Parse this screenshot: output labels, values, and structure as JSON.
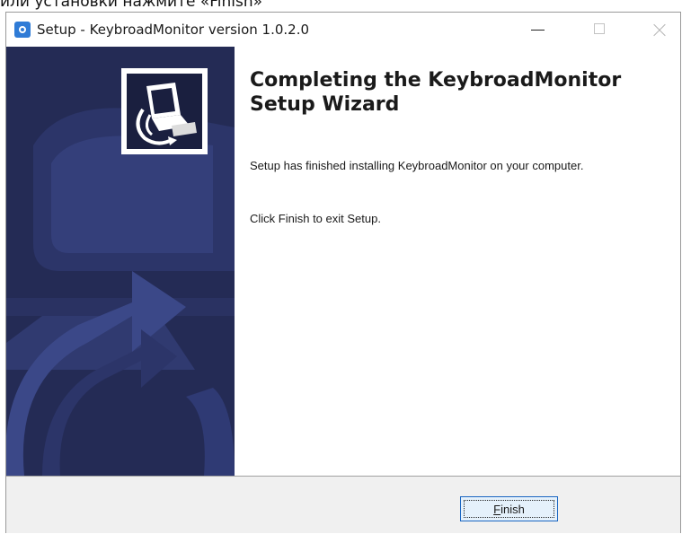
{
  "page_caption": "или установки нажмите «Finish»",
  "window": {
    "title": "Setup - KeybroadMonitor version 1.0.2.0",
    "app_icon": "setup-gear-icon",
    "controls": {
      "minimize_icon": "minimize-icon",
      "maximize_icon": "maximize-icon",
      "close_icon": "close-icon"
    }
  },
  "wizard": {
    "side_image": "installer-computer-logo",
    "heading_line1": "Completing the KeybroadMonitor",
    "heading_line2": "Setup Wizard",
    "message": "Setup has finished installing KeybroadMonitor on your computer.",
    "instruction": "Click Finish to exit Setup."
  },
  "footer": {
    "finish_mnemonic": "F",
    "finish_rest": "inish"
  },
  "colors": {
    "side_panel": "#242b55",
    "side_art": "#2f3a74",
    "footer": "#f0f0f0",
    "focus_border": "#1a66c2"
  }
}
